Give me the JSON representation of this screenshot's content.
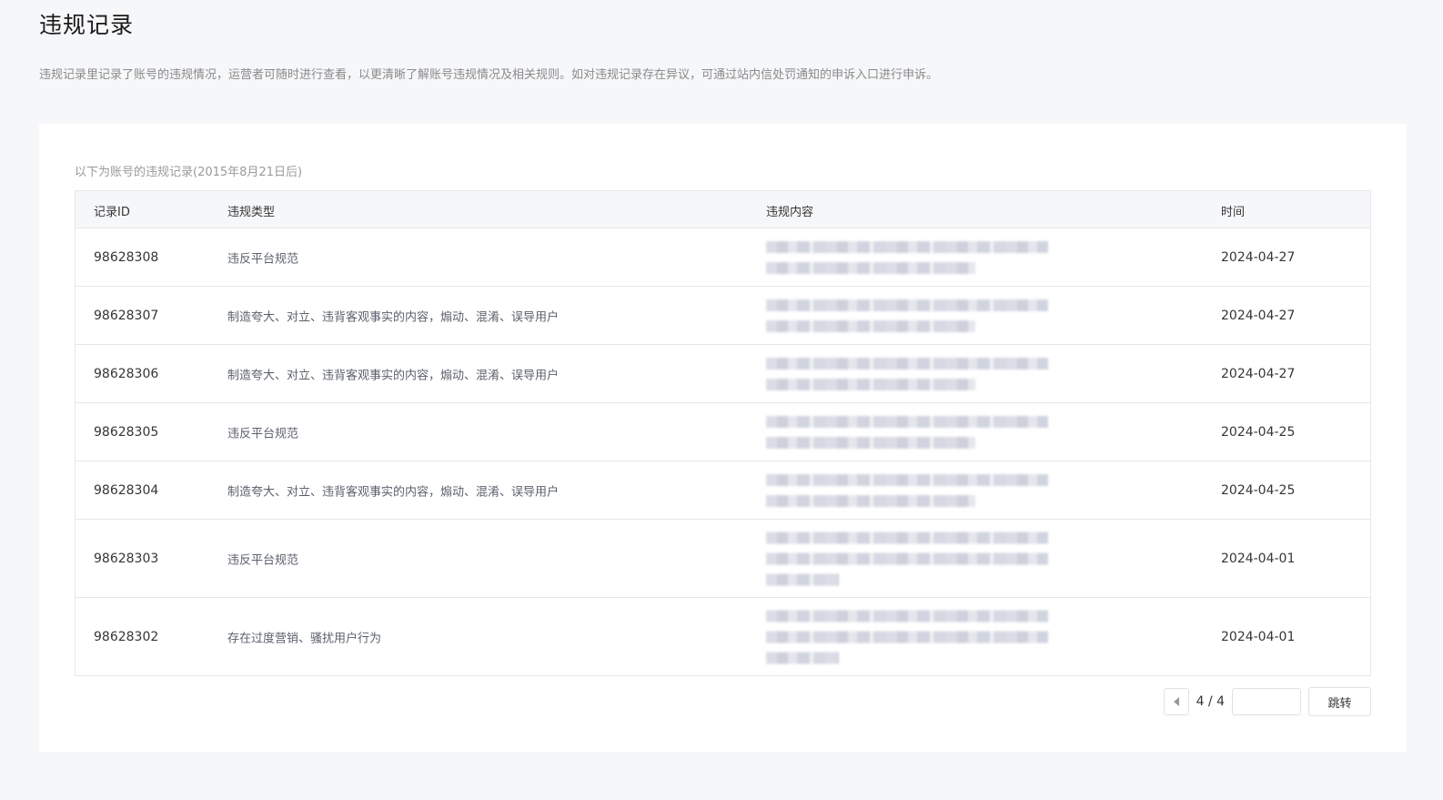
{
  "page": {
    "title": "违规记录",
    "description": "违规记录里记录了账号的违规情况，运营者可随时进行查看，以更清晰了解账号违规情况及相关规则。如对违规记录存在异议，可通过站内信处罚通知的申诉入口进行申诉。"
  },
  "card": {
    "subtitle": "以下为账号的违规记录(2015年8月21日后)"
  },
  "table": {
    "headers": {
      "id": "记录ID",
      "type": "违规类型",
      "content": "违规内容",
      "time": "时间"
    },
    "rows": [
      {
        "id": "98628308",
        "type": "违反平台规范",
        "time": "2024-04-27",
        "content_lines": 2
      },
      {
        "id": "98628307",
        "type": "制造夸大、对立、违背客观事实的内容，煽动、混淆、误导用户",
        "time": "2024-04-27",
        "content_lines": 2
      },
      {
        "id": "98628306",
        "type": "制造夸大、对立、违背客观事实的内容，煽动、混淆、误导用户",
        "time": "2024-04-27",
        "content_lines": 2
      },
      {
        "id": "98628305",
        "type": "违反平台规范",
        "time": "2024-04-25",
        "content_lines": 2
      },
      {
        "id": "98628304",
        "type": "制造夸大、对立、违背客观事实的内容，煽动、混淆、误导用户",
        "time": "2024-04-25",
        "content_lines": 2
      },
      {
        "id": "98628303",
        "type": "违反平台规范",
        "time": "2024-04-01",
        "content_lines": 3
      },
      {
        "id": "98628302",
        "type": "存在过度营销、骚扰用户行为",
        "time": "2024-04-01",
        "content_lines": 3
      }
    ]
  },
  "pagination": {
    "info": "4 / 4",
    "jump_label": "跳转",
    "input_value": ""
  }
}
